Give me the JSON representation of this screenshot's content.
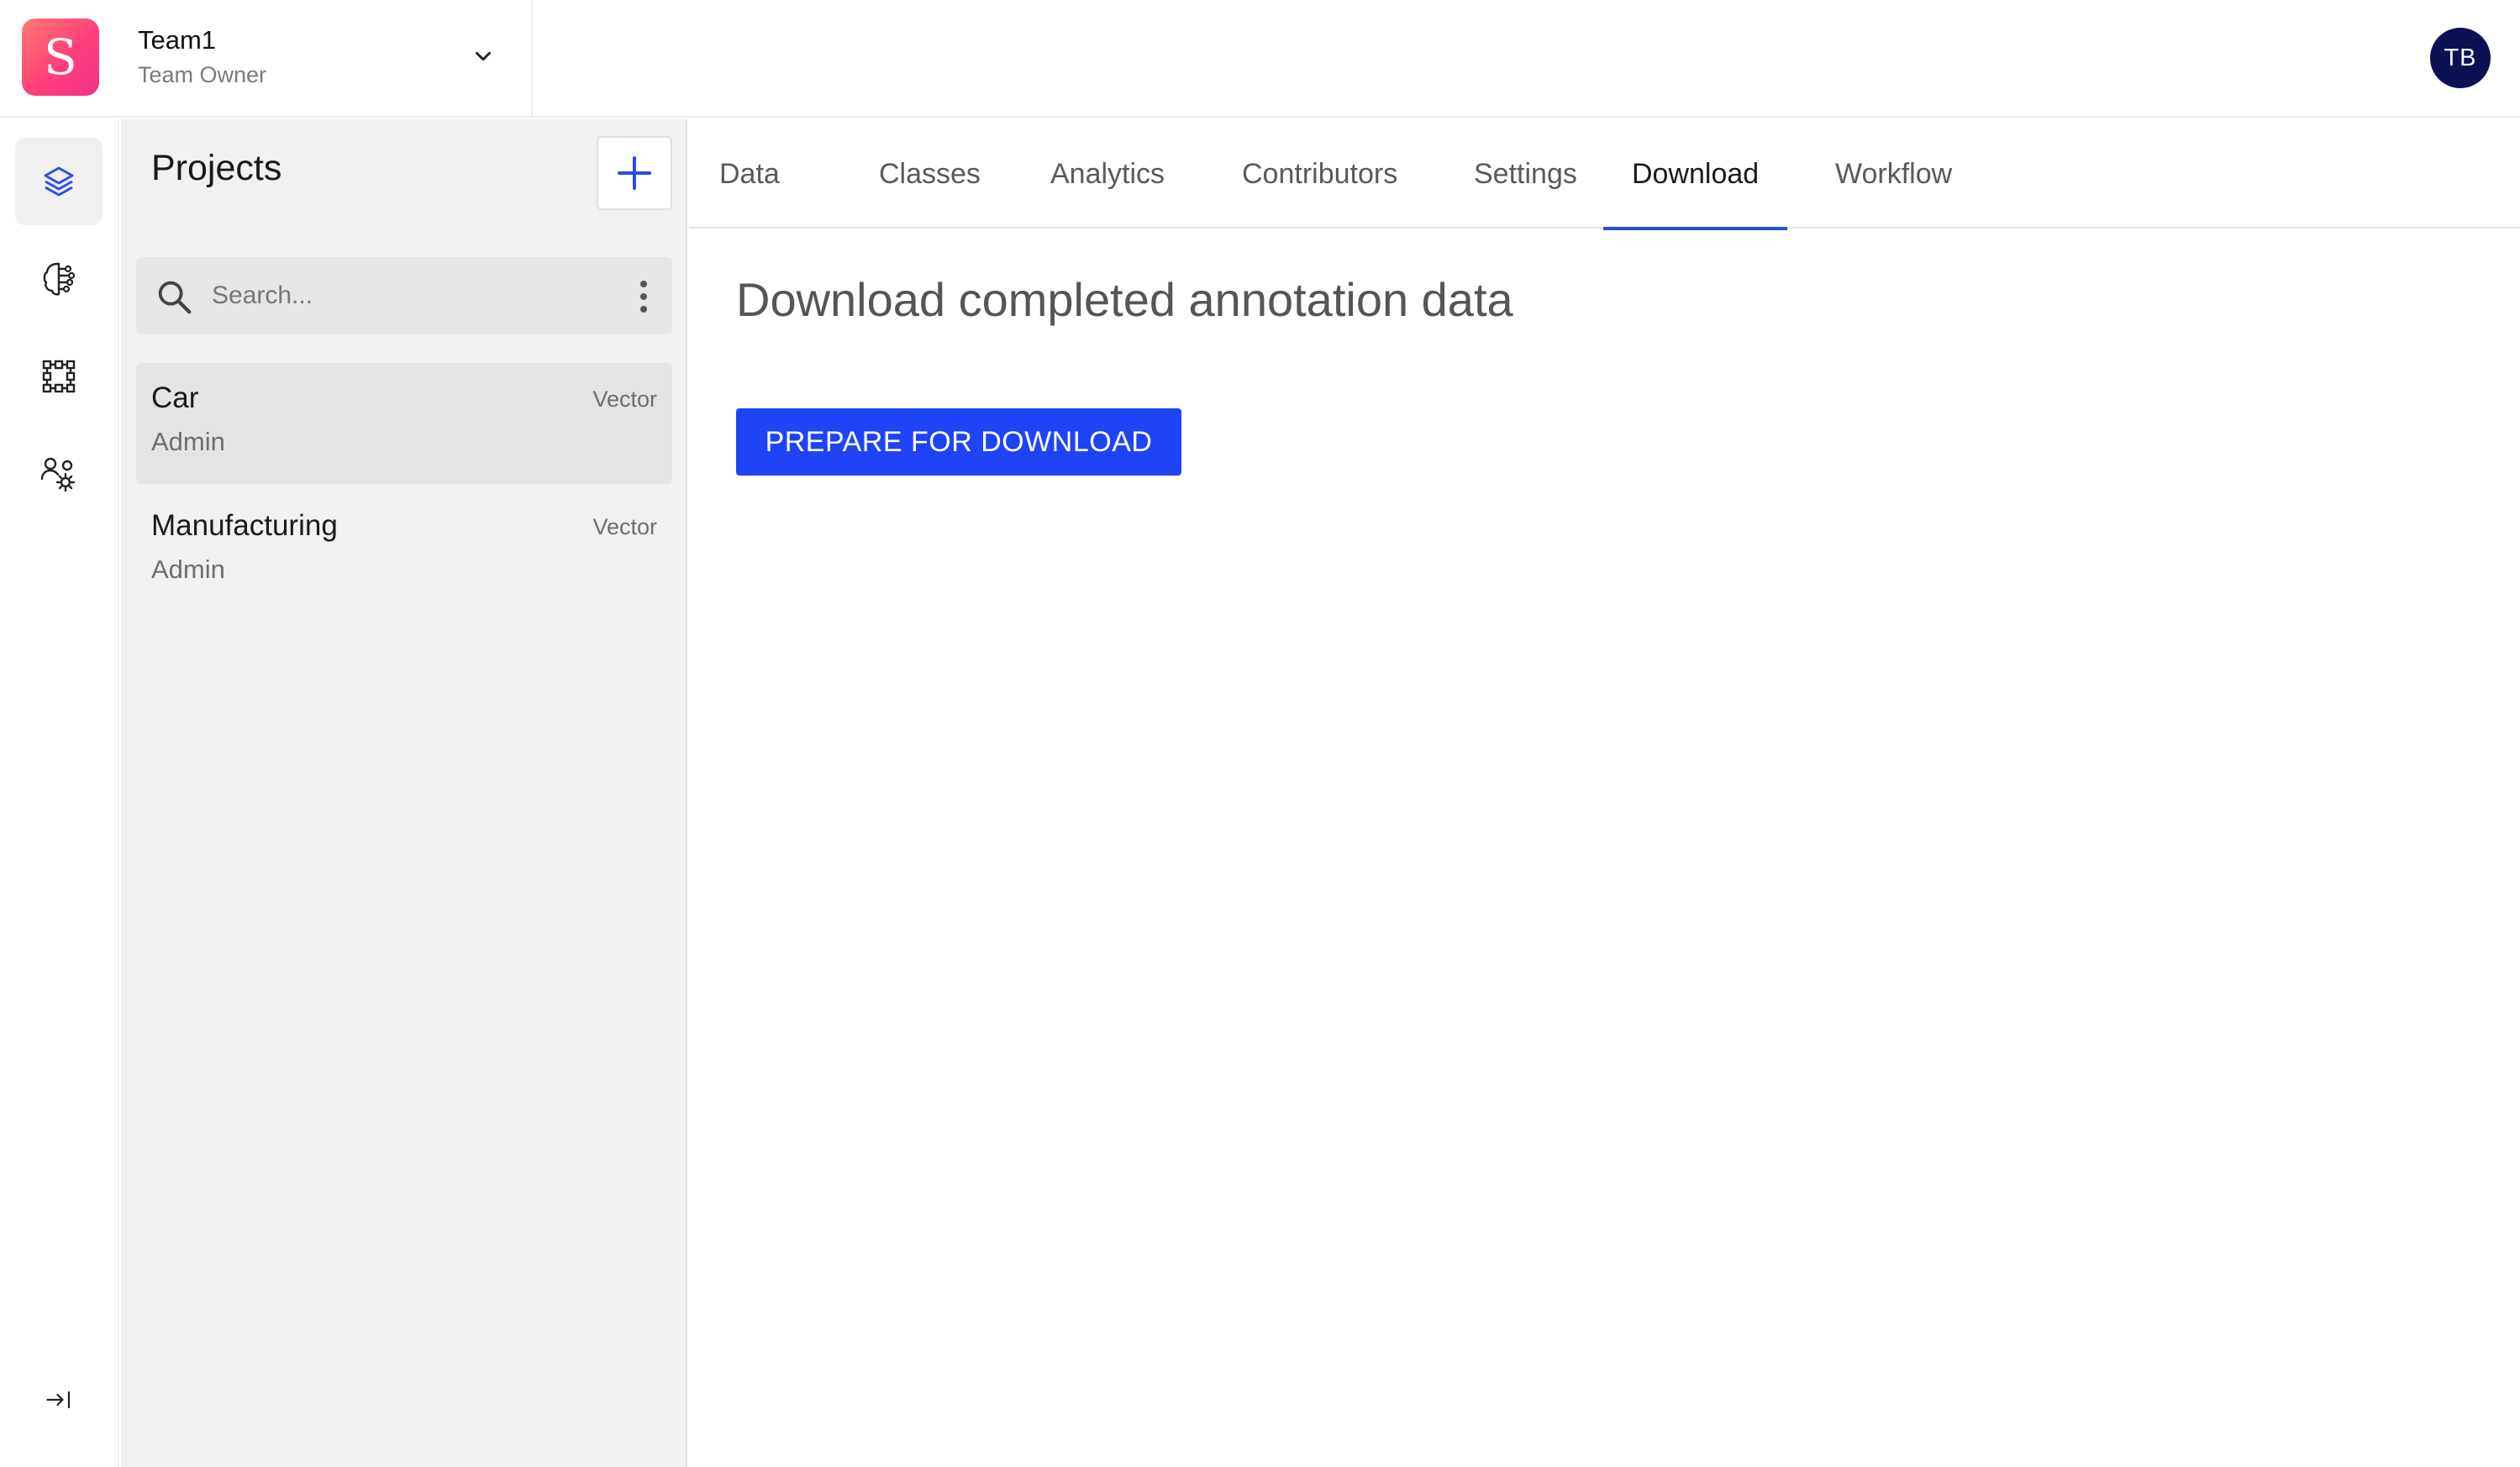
{
  "team": {
    "logo_letter": "S",
    "name": "Team1",
    "role": "Team Owner"
  },
  "user": {
    "initials": "TB"
  },
  "rail": {
    "items": [
      "projects-icon",
      "neural-network-icon",
      "workflow-icon",
      "team-settings-icon"
    ],
    "collapse_icon": "collapse-right-icon"
  },
  "projects_panel": {
    "title": "Projects",
    "search_placeholder": "Search...",
    "items": [
      {
        "name": "Car",
        "role": "Admin",
        "type": "Vector",
        "selected": true
      },
      {
        "name": "Manufacturing",
        "role": "Admin",
        "type": "Vector",
        "selected": false
      }
    ]
  },
  "tabs": [
    {
      "label": "Data"
    },
    {
      "label": "Classes"
    },
    {
      "label": "Analytics"
    },
    {
      "label": "Contributors"
    },
    {
      "label": "Settings"
    },
    {
      "label": "Download",
      "active": true
    },
    {
      "label": "Workflow"
    }
  ],
  "download": {
    "heading": "Download completed annotation data",
    "button_label": "PREPARE FOR DOWNLOAD"
  },
  "colors": {
    "accent": "#1f44f5",
    "avatar_bg": "#0c1054",
    "logo_gradient": [
      "#ff7a6e",
      "#f0328c"
    ]
  }
}
